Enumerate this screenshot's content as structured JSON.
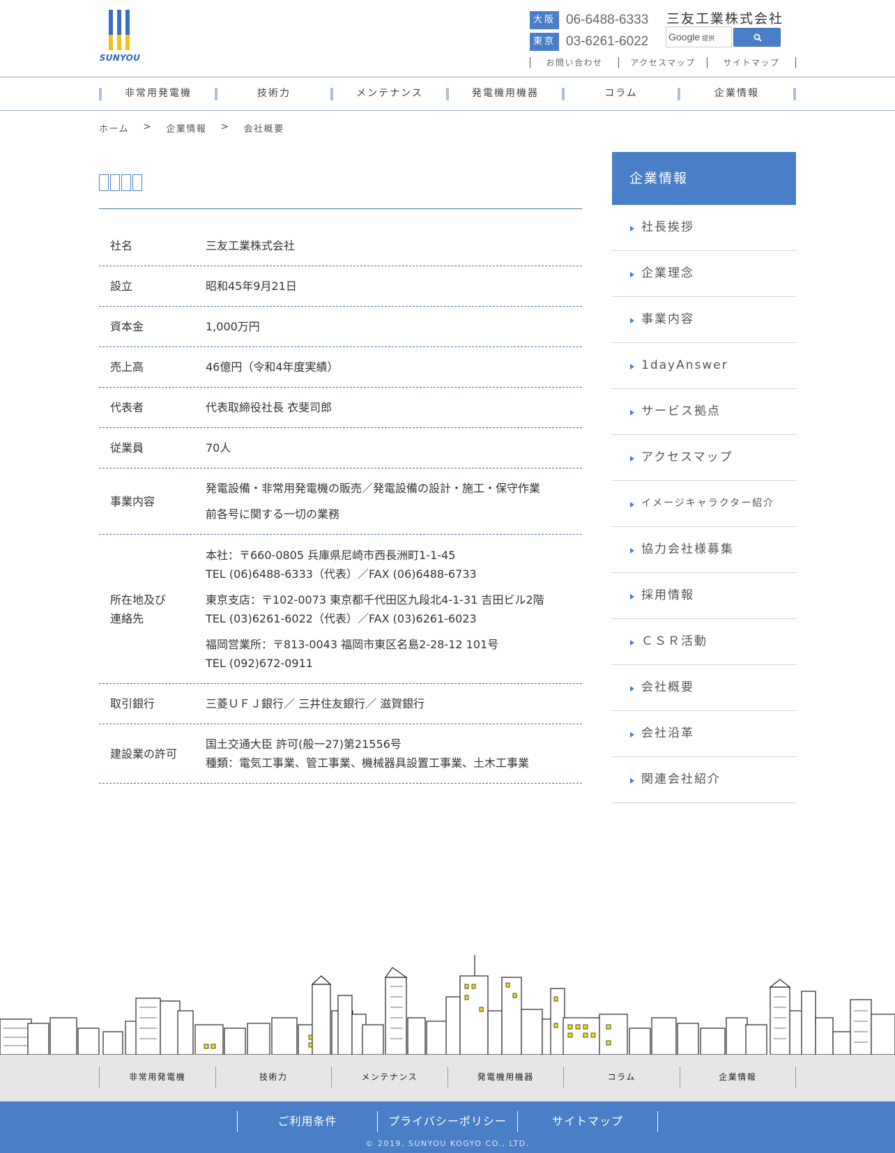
{
  "header": {
    "logo_text": "SUNYOU",
    "company_name": "三友工業株式会社",
    "phones": [
      {
        "tag": "大阪",
        "number": "06-6488-6333"
      },
      {
        "tag": "東京",
        "number": "03-6261-6022"
      }
    ],
    "search": {
      "brand": "Google",
      "brand_sub": "提供"
    },
    "util_links": [
      "お問い合わせ",
      "アクセスマップ",
      "サイトマップ"
    ]
  },
  "nav": [
    "非常用発電機",
    "技術力",
    "メンテナンス",
    "発電機用機器",
    "コラム",
    "企業情報"
  ],
  "breadcrumb": [
    "ホーム",
    "企業情報",
    "会社概要"
  ],
  "breadcrumb_sep": ">",
  "info": [
    {
      "key": "社名",
      "value": [
        "三友工業株式会社"
      ]
    },
    {
      "key": "設立",
      "value": [
        "昭和45年9月21日"
      ]
    },
    {
      "key": "資本金",
      "value": [
        "1,000万円"
      ]
    },
    {
      "key": "売上高",
      "value": [
        "46億円（令和4年度実績）"
      ]
    },
    {
      "key": "代表者",
      "value": [
        "代表取締役社長 衣斐司郎"
      ]
    },
    {
      "key": "従業員",
      "value": [
        "70人"
      ]
    },
    {
      "key": "事業内容",
      "value": [
        "発電設備・非常用発電機の販売／発電設備の設計・施工・保守作業",
        "前各号に関する一切の業務"
      ]
    },
    {
      "key": "所在地及び",
      "key2": "連絡先",
      "value": [
        "本社：〒660-0805 兵庫県尼崎市西長洲町1-1-45",
        "TEL (06)6488-6333（代表）／FAX (06)6488-6733",
        "東京支店：〒102-0073 東京都千代田区九段北4-1-31 吉田ビル2階",
        "TEL (03)6261-6022（代表）／FAX (03)6261-6023",
        "福岡営業所：〒813-0043 福岡市東区名島2-28-12 101号",
        "TEL (092)672-0911"
      ]
    },
    {
      "key": "取引銀行",
      "value": [
        "三菱ＵＦＪ銀行／ 三井住友銀行／ 滋賀銀行"
      ]
    },
    {
      "key": "建設業の許可",
      "value": [
        "国土交通大臣  許可(般一27)第21556号",
        "種類：電気工事業、管工事業、機械器具設置工事業、土木工事業"
      ]
    }
  ],
  "sidebar": {
    "title": "企業情報",
    "items": [
      "社長挨拶",
      "企業理念",
      "事業内容",
      "1dayAnswer",
      "サービス拠点",
      "アクセスマップ",
      "イメージキャラクター紹介",
      "協力会社様募集",
      "採用情報",
      "ＣＳＲ活動",
      "会社概要",
      "会社沿革",
      "関連会社紹介"
    ]
  },
  "footer": {
    "nav": [
      "非常用発電機",
      "技術力",
      "メンテナンス",
      "発電機用機器",
      "コラム",
      "企業情報"
    ],
    "links": [
      "ご利用条件",
      "プライバシーポリシー",
      "サイトマップ"
    ],
    "copyright": "© 2019, SUNYOU KOGYO CO., LTD."
  },
  "colors": {
    "accent": "#4a7fc7",
    "logo_yellow": "#f2c21b",
    "rule": "#4a70a8"
  }
}
